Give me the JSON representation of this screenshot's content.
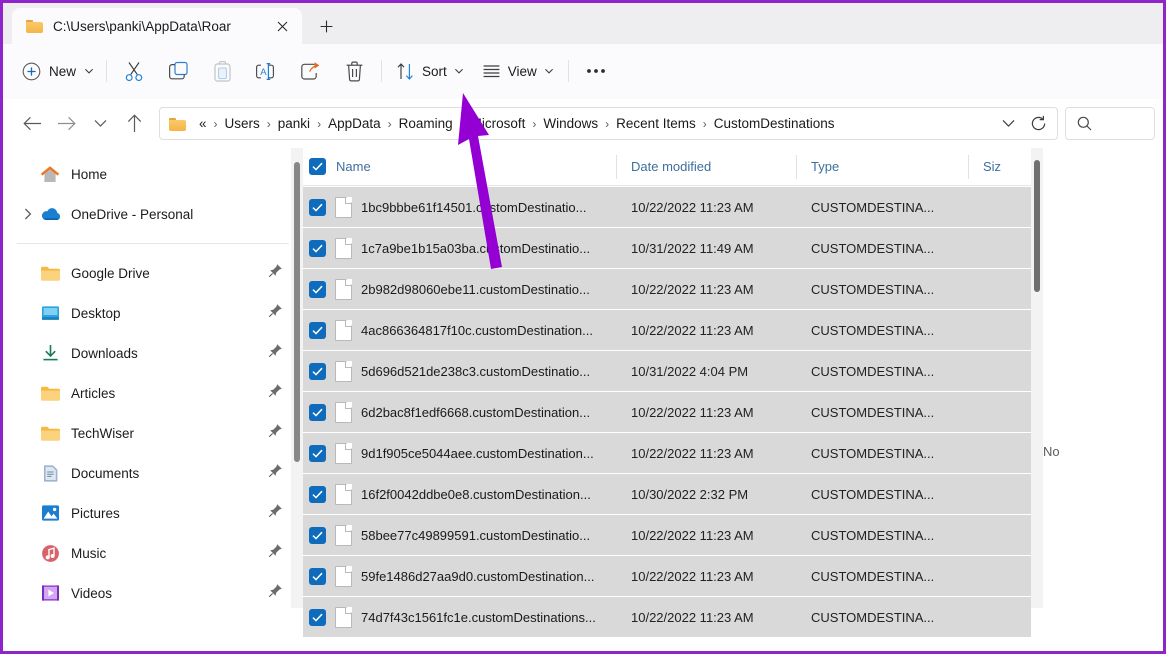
{
  "window": {
    "accent_purple": "#9400d3",
    "tab_bar_bg": "#eeeef1"
  },
  "tabbar": {
    "tab_title": "C:\\Users\\panki\\AppData\\Roar",
    "folder_icon": "folder-icon",
    "close_icon": "close-icon",
    "new_tab_icon": "plus-icon"
  },
  "toolbar": {
    "new_label": "New",
    "sort_label": "Sort",
    "view_label": "View",
    "items": [
      {
        "name": "new-button",
        "icon": "plus-circle-icon"
      },
      {
        "name": "cut-button",
        "icon": "scissors-icon"
      },
      {
        "name": "copy-button",
        "icon": "copy-icon"
      },
      {
        "name": "paste-button",
        "icon": "clipboard-icon"
      },
      {
        "name": "rename-button",
        "icon": "rename-icon"
      },
      {
        "name": "share-button",
        "icon": "share-icon"
      },
      {
        "name": "delete-button",
        "icon": "trash-icon"
      },
      {
        "name": "sort-button",
        "icon": "sort-icon"
      },
      {
        "name": "view-button",
        "icon": "view-list-icon"
      },
      {
        "name": "more-button",
        "icon": "ellipsis-icon"
      }
    ]
  },
  "navbar": {
    "back_icon": "arrow-left-icon",
    "forward_icon": "arrow-right-icon",
    "recent_icon": "chevron-down-icon",
    "up_icon": "arrow-up-icon",
    "overflow_label": "«",
    "breadcrumbs": [
      "Users",
      "panki",
      "AppData",
      "Roaming",
      "Microsoft",
      "Windows",
      "Recent Items",
      "CustomDestinations"
    ],
    "dropdown_icon": "chevron-down-icon",
    "refresh_icon": "refresh-icon",
    "search_placeholder": ""
  },
  "sidebar": {
    "groups": [
      {
        "items": [
          {
            "label": "Home",
            "icon": "home-icon",
            "expandable": false,
            "pinned": false
          },
          {
            "label": "OneDrive - Personal",
            "icon": "onedrive-icon",
            "expandable": true,
            "pinned": false
          }
        ]
      },
      {
        "items": [
          {
            "label": "Google Drive",
            "icon": "folder-icon",
            "expandable": false,
            "pinned": true
          },
          {
            "label": "Desktop",
            "icon": "desktop-icon",
            "expandable": false,
            "pinned": true
          },
          {
            "label": "Downloads",
            "icon": "download-icon",
            "expandable": false,
            "pinned": true
          },
          {
            "label": "Articles",
            "icon": "folder-icon",
            "expandable": false,
            "pinned": true
          },
          {
            "label": "TechWiser",
            "icon": "folder-icon",
            "expandable": false,
            "pinned": true
          },
          {
            "label": "Documents",
            "icon": "documents-icon",
            "expandable": false,
            "pinned": true
          },
          {
            "label": "Pictures",
            "icon": "pictures-icon",
            "expandable": false,
            "pinned": true
          },
          {
            "label": "Music",
            "icon": "music-icon",
            "expandable": false,
            "pinned": true
          },
          {
            "label": "Videos",
            "icon": "videos-icon",
            "expandable": false,
            "pinned": true
          }
        ]
      }
    ]
  },
  "filelist": {
    "columns": {
      "name": "Name",
      "date_modified": "Date modified",
      "type": "Type",
      "size": "Siz"
    },
    "select_all_checked": true,
    "sort_indicator": "ascending-caret-icon",
    "rows": [
      {
        "name": "1bc9bbbe61f14501.customDestinatio...",
        "date": "10/22/2022 11:23 AM",
        "type": "CUSTOMDESTINA...",
        "size": "",
        "checked": true
      },
      {
        "name": "1c7a9be1b15a03ba.customDestinatio...",
        "date": "10/31/2022 11:49 AM",
        "type": "CUSTOMDESTINA...",
        "size": "",
        "checked": true
      },
      {
        "name": "2b982d98060ebe11.customDestinatio...",
        "date": "10/22/2022 11:23 AM",
        "type": "CUSTOMDESTINA...",
        "size": "",
        "checked": true
      },
      {
        "name": "4ac866364817f10c.customDestination...",
        "date": "10/22/2022 11:23 AM",
        "type": "CUSTOMDESTINA...",
        "size": "",
        "checked": true
      },
      {
        "name": "5d696d521de238c3.customDestinatio...",
        "date": "10/31/2022 4:04 PM",
        "type": "CUSTOMDESTINA...",
        "size": "",
        "checked": true
      },
      {
        "name": "6d2bac8f1edf6668.customDestination...",
        "date": "10/22/2022 11:23 AM",
        "type": "CUSTOMDESTINA...",
        "size": "",
        "checked": true
      },
      {
        "name": "9d1f905ce5044aee.customDestination...",
        "date": "10/22/2022 11:23 AM",
        "type": "CUSTOMDESTINA...",
        "size": "",
        "checked": true
      },
      {
        "name": "16f2f0042ddbe0e8.customDestination...",
        "date": "10/30/2022 2:32 PM",
        "type": "CUSTOMDESTINA...",
        "size": "",
        "checked": true
      },
      {
        "name": "58bee77c49899591.customDestinatio...",
        "date": "10/22/2022 11:23 AM",
        "type": "CUSTOMDESTINA...",
        "size": "",
        "checked": true
      },
      {
        "name": "59fe1486d27aa9d0.customDestination...",
        "date": "10/22/2022 11:23 AM",
        "type": "CUSTOMDESTINA...",
        "size": "",
        "checked": true
      },
      {
        "name": "74d7f43c1561fc1e.customDestinations...",
        "date": "10/22/2022 11:23 AM",
        "type": "CUSTOMDESTINA...",
        "size": "",
        "checked": true
      }
    ]
  },
  "preview": {
    "message": "No"
  },
  "annotation": {
    "arrow": "purple-arrow-pointing-to-delete-button"
  }
}
